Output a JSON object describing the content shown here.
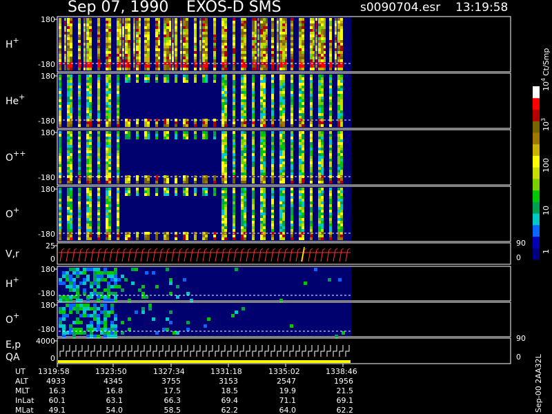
{
  "header": {
    "date": "Sep 07, 1990",
    "instrument": "EXOS-D SMS",
    "file": "s0090704.esr",
    "time": "13:19:58"
  },
  "colorbar": {
    "unit": "Ct/Smp",
    "ticks": [
      "1",
      "10",
      "100",
      "10",
      "10"
    ],
    "tick_exponents": [
      "",
      "",
      "",
      "3",
      "4"
    ],
    "colors": [
      "#000080",
      "#0000b4",
      "#0a64ff",
      "#00c8c8",
      "#00a050",
      "#00c800",
      "#7acd00",
      "#c8dc00",
      "#ffff00",
      "#c8b400",
      "#a07800",
      "#786400",
      "#b40000",
      "#ff0000",
      "#ffffff"
    ]
  },
  "footer_code": "Sep-00 2AA32L",
  "chart_data": [
    {
      "type": "heatmap",
      "panel": "H+",
      "label": "H",
      "charge": "+",
      "y_ticks": [
        "180",
        "-180"
      ],
      "ylim": [
        -180,
        180
      ]
    },
    {
      "type": "heatmap",
      "panel": "He+",
      "label": "He",
      "charge": "+",
      "y_ticks": [
        "180",
        "-180"
      ],
      "ylim": [
        -180,
        180
      ]
    },
    {
      "type": "heatmap",
      "panel": "O++",
      "label": "O",
      "charge": "++",
      "y_ticks": [
        "180",
        "-180"
      ],
      "ylim": [
        -180,
        180
      ]
    },
    {
      "type": "heatmap",
      "panel": "O+",
      "label": "O",
      "charge": "+",
      "y_ticks": [
        "180",
        "-180"
      ],
      "ylim": [
        -180,
        180
      ]
    },
    {
      "type": "line",
      "panel": "V,r",
      "label": "V,r",
      "y_ticks": [
        "25",
        "0"
      ],
      "right_ticks": [
        "90",
        "0"
      ],
      "ylim": [
        0,
        25
      ]
    },
    {
      "type": "heatmap",
      "panel": "H+ (lower)",
      "label": "H",
      "charge": "+",
      "y_ticks": [
        "180",
        "-180"
      ],
      "ylim": [
        -180,
        180
      ]
    },
    {
      "type": "heatmap",
      "panel": "O+ (lower)",
      "label": "O",
      "charge": "+",
      "y_ticks": [
        "180",
        "-180"
      ],
      "ylim": [
        -180,
        180
      ]
    },
    {
      "type": "line",
      "panel": "E,p QA",
      "label": "E,p",
      "label2": "QA",
      "y_ticks": [
        "4000",
        "0"
      ],
      "right_ticks": [
        "90",
        "0"
      ],
      "ylim": [
        0,
        4000
      ]
    }
  ],
  "ephemeris": {
    "row_labels": [
      "UT",
      "ALT",
      "MLT",
      "InLat",
      "MLat"
    ],
    "columns": [
      [
        "1319:58",
        "4933",
        "16.3",
        "60.1",
        "49.1"
      ],
      [
        "1323:50",
        "4345",
        "16.8",
        "63.1",
        "54.0"
      ],
      [
        "1327:34",
        "3755",
        "17.5",
        "66.3",
        "58.5"
      ],
      [
        "1331:18",
        "3153",
        "18.5",
        "69.4",
        "62.2"
      ],
      [
        "1335:02",
        "2547",
        "19.9",
        "71.1",
        "64.0"
      ],
      [
        "1338:46",
        "1956",
        "21.5",
        "69.1",
        "62.2"
      ]
    ]
  }
}
